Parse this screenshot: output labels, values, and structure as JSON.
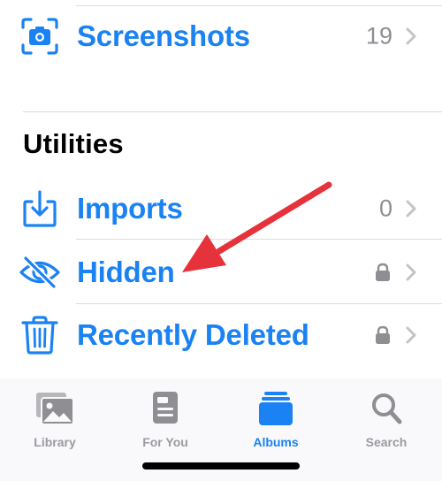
{
  "albums": {
    "screenshots": {
      "label": "Screenshots",
      "count": "19",
      "icon": "screenshot-icon"
    }
  },
  "utilities": {
    "title": "Utilities",
    "items": [
      {
        "label": "Imports",
        "count": "0",
        "icon": "import-icon"
      },
      {
        "label": "Hidden",
        "icon": "eye-slash-icon",
        "locked": true
      },
      {
        "label": "Recently Deleted",
        "icon": "trash-icon",
        "locked": true
      }
    ]
  },
  "tabbar": {
    "tabs": [
      {
        "label": "Library",
        "icon": "photos-icon",
        "active": false
      },
      {
        "label": "For You",
        "icon": "for-you-icon",
        "active": false
      },
      {
        "label": "Albums",
        "icon": "albums-icon",
        "active": true
      },
      {
        "label": "Search",
        "icon": "search-icon",
        "active": false
      }
    ]
  },
  "colors": {
    "accent": "#1a82f2",
    "secondary_text": "#8e8e93",
    "annotation_arrow": "#e6323a"
  }
}
